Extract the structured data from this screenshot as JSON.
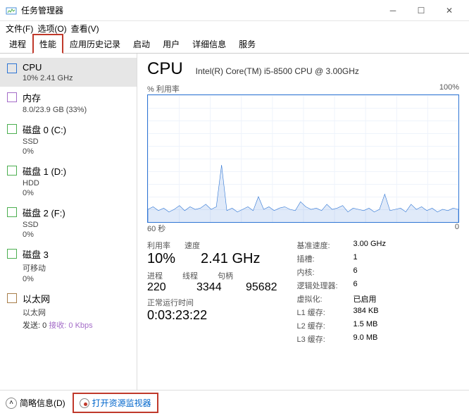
{
  "window": {
    "title": "任务管理器"
  },
  "menu": {
    "file": "文件(F)",
    "options": "选项(O)",
    "view": "查看(V)"
  },
  "tabs": [
    "进程",
    "性能",
    "应用历史记录",
    "启动",
    "用户",
    "详细信息",
    "服务"
  ],
  "sidebar": [
    {
      "title": "CPU",
      "sub": "10% 2.41 GHz",
      "color": "blue",
      "selected": true
    },
    {
      "title": "内存",
      "sub": "8.0/23.9 GB (33%)",
      "color": "purple"
    },
    {
      "title": "磁盘 0 (C:)",
      "sub": "SSD",
      "sub2": "0%",
      "color": "green"
    },
    {
      "title": "磁盘 1 (D:)",
      "sub": "HDD",
      "sub2": "0%",
      "color": "green"
    },
    {
      "title": "磁盘 2 (F:)",
      "sub": "SSD",
      "sub2": "0%",
      "color": "green"
    },
    {
      "title": "磁盘 3",
      "sub": "可移动",
      "sub2": "0%",
      "color": "green"
    },
    {
      "title": "以太网",
      "sub": "以太网",
      "net": {
        "send": "发送: 0",
        "recv": "接收: 0 Kbps"
      },
      "color": "brown"
    }
  ],
  "main": {
    "title": "CPU",
    "model": "Intel(R) Core(TM) i5-8500 CPU @ 3.00GHz",
    "chart_toplabel_left": "% 利用率",
    "chart_toplabel_right": "100%",
    "chart_xleft": "60 秒",
    "chart_xright": "0",
    "labels": {
      "util": "利用率",
      "speed": "速度",
      "procs": "进程",
      "threads": "线程",
      "handles": "句柄",
      "uptime": "正常运行时间"
    },
    "values": {
      "util": "10%",
      "speed": "2.41 GHz",
      "procs": "220",
      "threads": "3344",
      "handles": "95682",
      "uptime": "0:03:23:22"
    },
    "right": {
      "base_speed_l": "基准速度:",
      "base_speed_v": "3.00 GHz",
      "sockets_l": "插槽:",
      "sockets_v": "1",
      "cores_l": "内核:",
      "cores_v": "6",
      "logical_l": "逻辑处理器:",
      "logical_v": "6",
      "virt_l": "虚拟化:",
      "virt_v": "已启用",
      "l1_l": "L1 缓存:",
      "l1_v": "384 KB",
      "l2_l": "L2 缓存:",
      "l2_v": "1.5 MB",
      "l3_l": "L3 缓存:",
      "l3_v": "9.0 MB"
    }
  },
  "footer": {
    "collapse": "简略信息(D)",
    "resmon": "打开资源监视器"
  },
  "chart_data": {
    "type": "line",
    "title": "% 利用率",
    "ylim": [
      0,
      100
    ],
    "xrange_seconds": [
      60,
      0
    ],
    "values": [
      10,
      12,
      9,
      11,
      8,
      10,
      13,
      9,
      12,
      10,
      11,
      14,
      10,
      12,
      45,
      9,
      11,
      8,
      10,
      12,
      9,
      20,
      10,
      12,
      9,
      11,
      12,
      10,
      9,
      16,
      12,
      10,
      11,
      9,
      14,
      10,
      11,
      13,
      8,
      11,
      10,
      9,
      11,
      8,
      10,
      22,
      9,
      10,
      11,
      8,
      14,
      10,
      12,
      9,
      11,
      8,
      10,
      9,
      11,
      10
    ]
  }
}
